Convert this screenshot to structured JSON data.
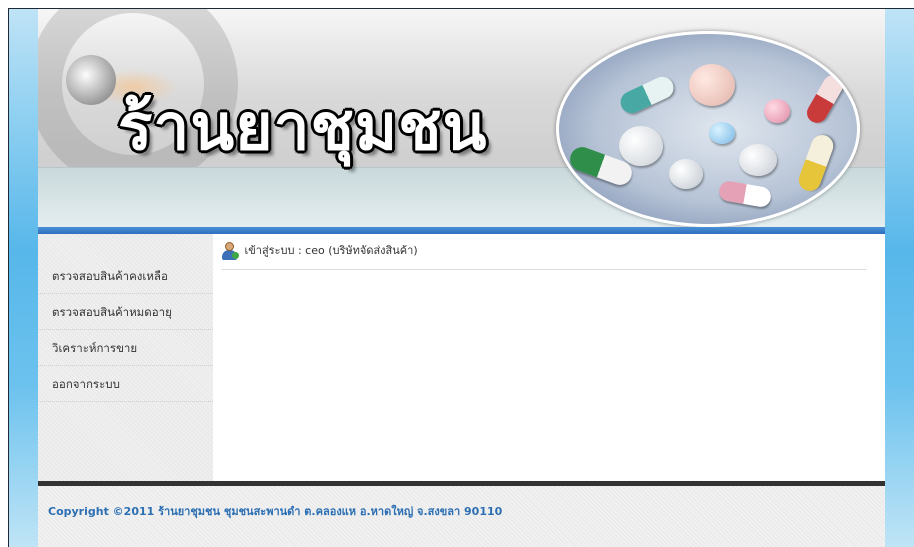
{
  "header": {
    "site_title": "ร้านยาชุมชน"
  },
  "sidebar": {
    "items": [
      {
        "label": "ตรวจสอบสินค้าคงเหลือ"
      },
      {
        "label": "ตรวจสอบสินค้าหมดอายุ"
      },
      {
        "label": "วิเคราะห์การขาย"
      },
      {
        "label": "ออกจากระบบ"
      }
    ]
  },
  "main": {
    "login_status": "เข้าสู่ระบบ : ceo (บริษัทจัดส่งสินค้า)",
    "user_icon": "user-add-icon"
  },
  "footer": {
    "copyright": "Copyright ©2011 ร้านยาชุมชน ชุมชนสะพานดำ ต.คลองแห อ.หาดใหญ่ จ.สงขลา 90110"
  },
  "colors": {
    "accent_blue": "#2f6fbf",
    "footer_text": "#2c6fb2",
    "frame_bg": "#57b7ea"
  }
}
